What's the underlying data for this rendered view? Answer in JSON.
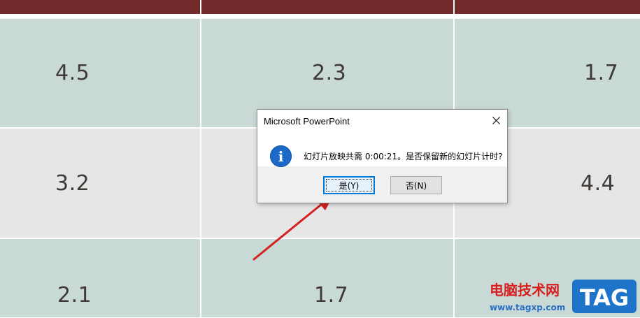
{
  "table": {
    "rows": [
      [
        "4.5",
        "2.3",
        "1.7"
      ],
      [
        "3.2",
        "",
        "4.4"
      ],
      [
        "2.1",
        "1.7",
        ""
      ]
    ],
    "colors": {
      "header": "#722a2b",
      "row_a": "#c9d9d6",
      "row_b": "#e6e6e6"
    }
  },
  "dialog": {
    "title": "Microsoft PowerPoint",
    "message": "幻灯片放映共需 0:00:21。是否保留新的幻灯片计时?",
    "icon": "info-icon",
    "buttons": {
      "yes": "是(Y)",
      "no": "否(N)"
    }
  },
  "watermark": {
    "site": "电脑技术网",
    "url": "www.tagxp.com",
    "logo": "TAG"
  },
  "annotation": {
    "arrow_color": "#d42020"
  }
}
